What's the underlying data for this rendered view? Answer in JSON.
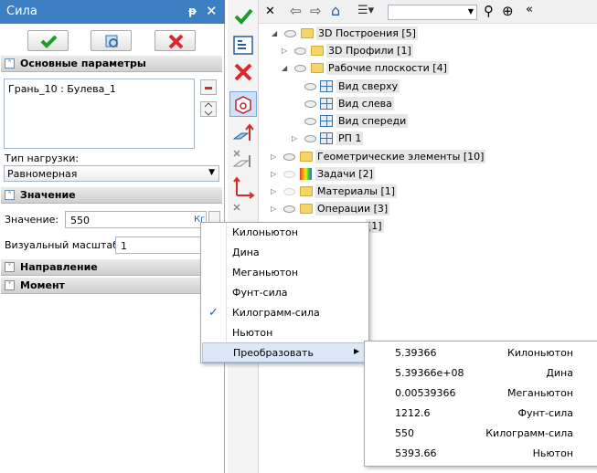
{
  "panel": {
    "title": "Сила",
    "pin_glyph": "ᵽ",
    "close_glyph": "✕",
    "section_main": "Основные параметры",
    "selection_item": "Грань_10 : Булева_1",
    "load_type_label": "Тип нагрузки:",
    "load_type_value": "Равномерная",
    "section_value": "Значение",
    "value_label": "Значение:",
    "value_input": "550",
    "unit_abbrev": "Кг",
    "scale_label": "Визуальный масштаб:",
    "scale_value": "1",
    "section_direction": "Направление",
    "section_moment": "Момент"
  },
  "tree": {
    "nodes": [
      {
        "label": "3D Построения [5]"
      },
      {
        "label": "3D Профили [1]"
      },
      {
        "label": "Рабочие плоскости [4]"
      },
      {
        "label": "Вид сверху"
      },
      {
        "label": "Вид слева"
      },
      {
        "label": "Вид спереди"
      },
      {
        "label": "РП 1"
      },
      {
        "label": "Геометрические элементы [10]"
      },
      {
        "label": "Задачи [2]"
      },
      {
        "label": "Материалы [1]"
      },
      {
        "label": "Операции [3]"
      },
      {
        "label": "[1]"
      }
    ]
  },
  "unit_menu": {
    "items": [
      "Килоньютон",
      "Дина",
      "Меганьютон",
      "Фунт-сила",
      "Килограмм-сила",
      "Ньютон",
      "Преобразовать"
    ],
    "checked": "Килограмм-сила"
  },
  "convert_menu": {
    "rows": [
      {
        "value": "5.39366",
        "unit": "Килоньютон"
      },
      {
        "value": "5.39366e+08",
        "unit": "Дина"
      },
      {
        "value": "0.00539366",
        "unit": "Меганьютон"
      },
      {
        "value": "1212.6",
        "unit": "Фунт-сила"
      },
      {
        "value": "550",
        "unit": "Килограмм-сила"
      },
      {
        "value": "5393.66",
        "unit": "Ньютон"
      }
    ]
  },
  "icons": {
    "ok": "check-icon",
    "cancel": "x-icon",
    "preview": "preview-icon",
    "remove": "minus-icon",
    "reorder": "updown-icon"
  },
  "colors": {
    "title_bar": "#3c7fc3",
    "ok_green": "#1e9b2b",
    "cancel_red": "#e0262a",
    "menu_hover": "#dce8f7"
  }
}
